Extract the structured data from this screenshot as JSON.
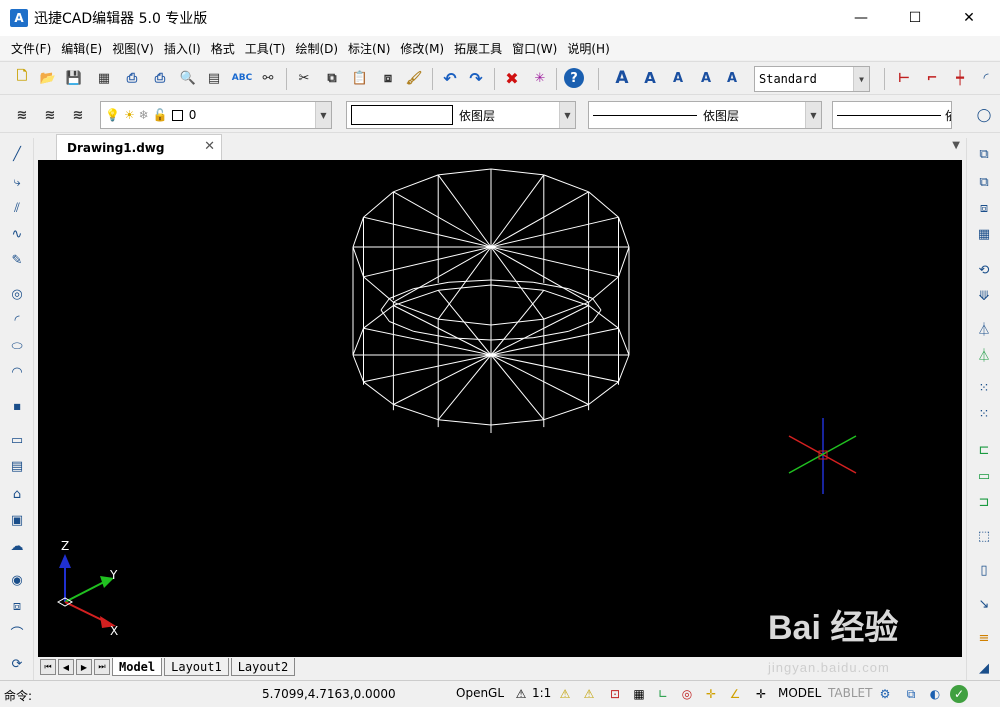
{
  "window": {
    "title": "迅捷CAD编辑器 5.0 专业版",
    "logo": "A",
    "controls": [
      "minimize-icon",
      "maximize-icon",
      "close-icon"
    ]
  },
  "menu": {
    "items": [
      "文件(F)",
      "编辑(E)",
      "视图(V)",
      "插入(I)",
      "格式",
      "工具(T)",
      "绘制(D)",
      "标注(N)",
      "修改(M)",
      "拓展工具",
      "窗口(W)",
      "说明(H)"
    ]
  },
  "toolbar": {
    "text_style": "Standard",
    "layer_name": "0",
    "color_label": "依图层",
    "linetype_label": "依图层",
    "lineweight_label": "依"
  },
  "document": {
    "tab_label": "Drawing1.dwg",
    "close_glyph": "✕"
  },
  "ucs": {
    "z_label": "Z",
    "y_label": "Y",
    "x_label": "X"
  },
  "layouts": {
    "tabs": [
      "Model",
      "Layout1",
      "Layout2"
    ],
    "active": "Model"
  },
  "status": {
    "command_label": "命令:",
    "coordinates": "5.7099,4.7163,0.0000",
    "renderer": "OpenGL",
    "scale": "1:1",
    "model_label": "MODEL",
    "tablet_label": "TABLET"
  },
  "watermark": {
    "brand": "Bai 经验",
    "url": "jingyan.baidu.com"
  },
  "colors": {
    "canvas_bg": "#000000",
    "wireframe": "#ffffff",
    "axis_x": "#d42020",
    "axis_y": "#20c020",
    "axis_z": "#2030d0"
  }
}
